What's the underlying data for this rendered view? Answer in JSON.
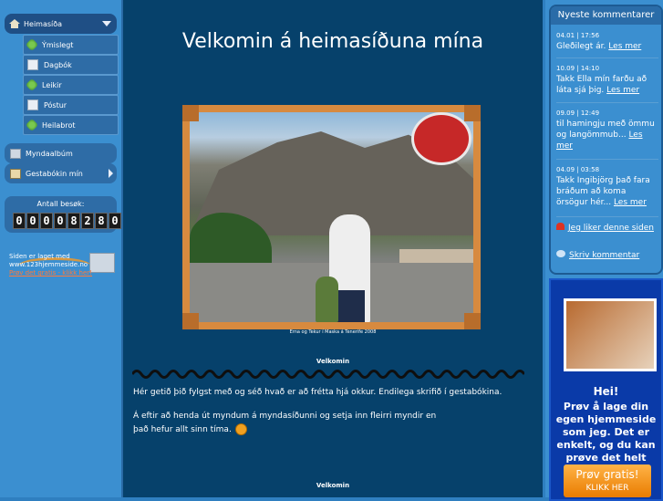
{
  "nav": {
    "top": {
      "label": "Heimasíða",
      "icon": "house-icon"
    },
    "sub_items": [
      {
        "label": "Ýmislegt",
        "icon": "green-puzzle-icon"
      },
      {
        "label": "Dagbók",
        "icon": "page-icon"
      },
      {
        "label": "Leikir",
        "icon": "green-puzzle-icon"
      },
      {
        "label": "Póstur",
        "icon": "page-icon"
      },
      {
        "label": "Heilabrot",
        "icon": "green-puzzle-icon"
      }
    ],
    "album": {
      "label": "Myndaalbúm",
      "icon": "album-icon"
    },
    "guestbook": {
      "label": "Gestabókin mín",
      "icon": "book-icon"
    }
  },
  "counter": {
    "title": "Antall besøk:",
    "digits": [
      "0",
      "0",
      "0",
      "0",
      "8",
      "2",
      "8",
      "0"
    ]
  },
  "made_with": {
    "line1": "Siden er laget med",
    "line2": "www.123hjemmeside.no",
    "line3": "Prøv det gratis - klikk her!"
  },
  "main": {
    "title": "Velkomin á heimasíðuna mína",
    "photo_caption": "Erna og Tekur í Maska á Tenerife 2008",
    "section_heading": "Velkomin",
    "paragraph1": "Hér getið þið fylgst með og séð hvað er að frétta hjá okkur. Endilega skrifið í gestabókina.",
    "paragraph2_line1": "Á eftir að henda út myndum á myndasíðunni og setja inn fleirri myndir en",
    "paragraph2_line2": "það hefur allt sinn tíma.",
    "section_heading2": "Velkomin"
  },
  "comments": {
    "header": "Nyeste kommentarer",
    "items": [
      {
        "date": "04.01 | 17:56",
        "text": "Gleðilegt ár.",
        "more": "Les mer"
      },
      {
        "date": "10.09 | 14:10",
        "text": "Takk Ella mín farðu að láta sjá þig.",
        "more": "Les mer"
      },
      {
        "date": "09.09 | 12:49",
        "text": "til hamingju með ömmu og langömmub...",
        "more": "Les mer"
      },
      {
        "date": "04.09 | 03:58",
        "text": "Takk Ingibjörg það fara bráðum að koma örsögur hér...",
        "more": "Les mer"
      }
    ],
    "like_label": "Jeg liker denne siden",
    "write_label": "Skriv kommentar"
  },
  "ad": {
    "title": "Hei!",
    "text": "Prøv å lage din egen hjemmeside som jeg. Det er enkelt, og du kan prøve det helt gratis.",
    "button_line1": "Prøv gratis!",
    "button_line2": "KLIKK HER"
  },
  "colors": {
    "background": "#2f7fc0",
    "main_bg": "#06416b",
    "ad_bg": "#0a3aa8",
    "accent_orange": "#e97c00"
  }
}
